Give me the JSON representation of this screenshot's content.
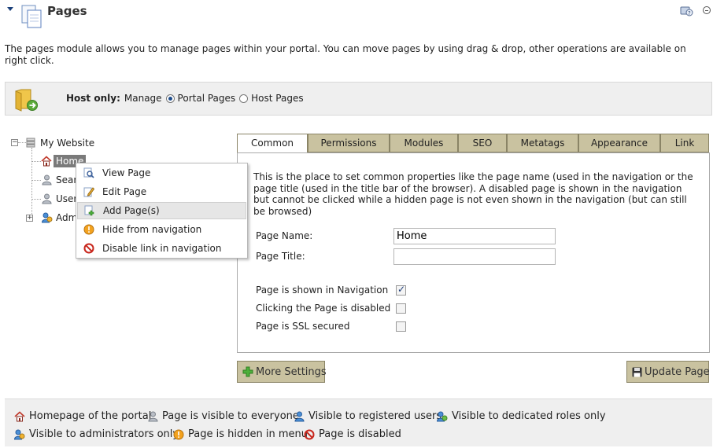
{
  "header": {
    "title": "Pages",
    "collapse_icon": "collapse-arrow-icon",
    "help_icon": "help-icon",
    "minimize_icon": "minimize-icon"
  },
  "description": "The pages module allows you to manage pages within your portal. You can move pages by using drag & drop, other operations are available on right click.",
  "host_bar": {
    "label": "Host only:",
    "manage_label": "Manage",
    "options": [
      {
        "label": "Portal Pages",
        "selected": true
      },
      {
        "label": "Host Pages",
        "selected": false
      }
    ]
  },
  "tree": {
    "root": "My Website",
    "nodes": [
      "Home",
      "Searc",
      "User",
      "Adm"
    ]
  },
  "context_menu": {
    "items": [
      {
        "label": "View Page",
        "icon": "view-page-icon"
      },
      {
        "label": "Edit Page",
        "icon": "edit-page-icon"
      },
      {
        "label": "Add Page(s)",
        "icon": "add-page-icon",
        "highlighted": true
      },
      {
        "label": "Hide from navigation",
        "icon": "hide-icon"
      },
      {
        "label": "Disable link in navigation",
        "icon": "disable-icon"
      }
    ]
  },
  "tabs": [
    "Common",
    "Permissions",
    "Modules",
    "SEO",
    "Metatags",
    "Appearance",
    "Link"
  ],
  "active_tab": "Common",
  "common": {
    "description": "This is the place to set common properties like the page name (used in the navigation or the page title (used in the title bar of the browser). A disabled page is shown in the navigation but cannot be clicked while a hidden page is not even shown in the navigation (but can still be browsed)",
    "page_name_label": "Page Name:",
    "page_name_value": "Home",
    "page_title_label": "Page Title:",
    "page_title_value": "",
    "shown_in_nav_label": "Page is shown in Navigation",
    "shown_in_nav": true,
    "clicking_disabled_label": "Clicking the Page is disabled",
    "clicking_disabled": false,
    "ssl_label": "Page is SSL secured",
    "ssl": false
  },
  "buttons": {
    "more_settings": "More Settings",
    "update_page": "Update Page"
  },
  "legend": [
    {
      "label": "Homepage of the portal",
      "icon": "home-icon"
    },
    {
      "label": "Page is visible to everyone",
      "icon": "everyone-icon"
    },
    {
      "label": "Visible to registered users",
      "icon": "registered-user-icon"
    },
    {
      "label": "Visible to dedicated roles only",
      "icon": "roles-icon"
    },
    {
      "label": "Visible to administrators only",
      "icon": "admin-icon"
    },
    {
      "label": "Page is hidden in menu",
      "icon": "hidden-icon"
    },
    {
      "label": "Page is disabled",
      "icon": "disabled-icon"
    }
  ],
  "colors": {
    "tab_bg": "#c9c2a0",
    "accent": "#1f4d8c",
    "selected_node": "#7a7a7a"
  }
}
